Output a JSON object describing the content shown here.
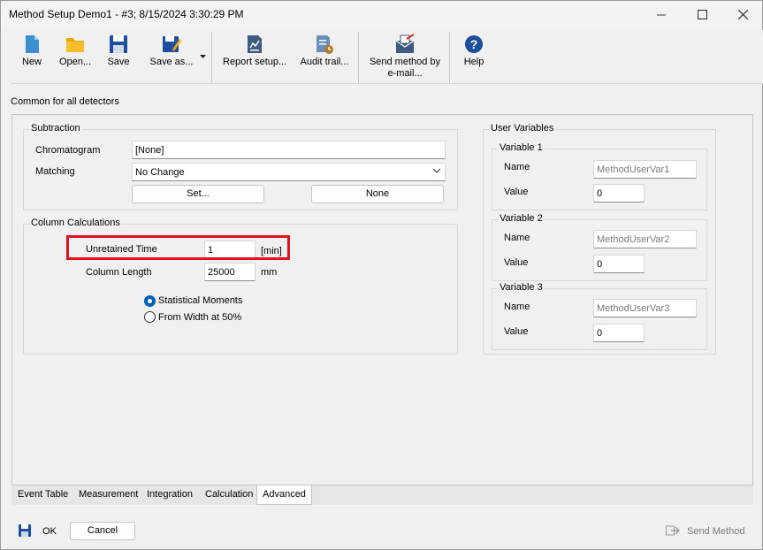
{
  "window": {
    "title": "Method Setup Demo1 - #3;   8/15/2024   3:30:29 PM"
  },
  "toolbar": {
    "new": "New",
    "open": "Open...",
    "save": "Save",
    "save_as": "Save as...",
    "report_setup": "Report setup...",
    "audit_trail": "Audit trail...",
    "send_method_line1": "Send method by",
    "send_method_line2": "e-mail...",
    "help": "Help"
  },
  "section_header": "Common for all detectors",
  "subtraction": {
    "title": "Subtraction",
    "chromatogram_label": "Chromatogram",
    "chromatogram_value": "[None]",
    "matching_label": "Matching",
    "matching_value": "No Change",
    "set_button": "Set...",
    "none_button": "None"
  },
  "column_calculations": {
    "title": "Column Calculations",
    "unretained_time_label": "Unretained Time",
    "unretained_time_value": "1",
    "unretained_time_unit": "[min]",
    "column_length_label": "Column Length",
    "column_length_value": "25000",
    "column_length_unit": "mm",
    "option_statistical": "Statistical Moments",
    "option_width": "From Width at 50%",
    "selected_option": "Statistical Moments"
  },
  "user_variables": {
    "title": "User Variables",
    "variables": [
      {
        "title": "Variable 1",
        "name_label": "Name",
        "name_value": "MethodUserVar1",
        "value_label": "Value",
        "value": "0"
      },
      {
        "title": "Variable 2",
        "name_label": "Name",
        "name_value": "MethodUserVar2",
        "value_label": "Value",
        "value": "0"
      },
      {
        "title": "Variable 3",
        "name_label": "Name",
        "name_value": "MethodUserVar3",
        "value_label": "Value",
        "value": "0"
      }
    ]
  },
  "tabs": [
    {
      "label": "Event Table"
    },
    {
      "label": "Measurement"
    },
    {
      "label": "Integration"
    },
    {
      "label": "Calculation"
    },
    {
      "label": "Advanced"
    }
  ],
  "active_tab": "Advanced",
  "footer": {
    "ok": "OK",
    "cancel": "Cancel",
    "send_method": "Send Method"
  },
  "colors": {
    "accent": "#005fb8",
    "highlight": "#e0141e"
  }
}
